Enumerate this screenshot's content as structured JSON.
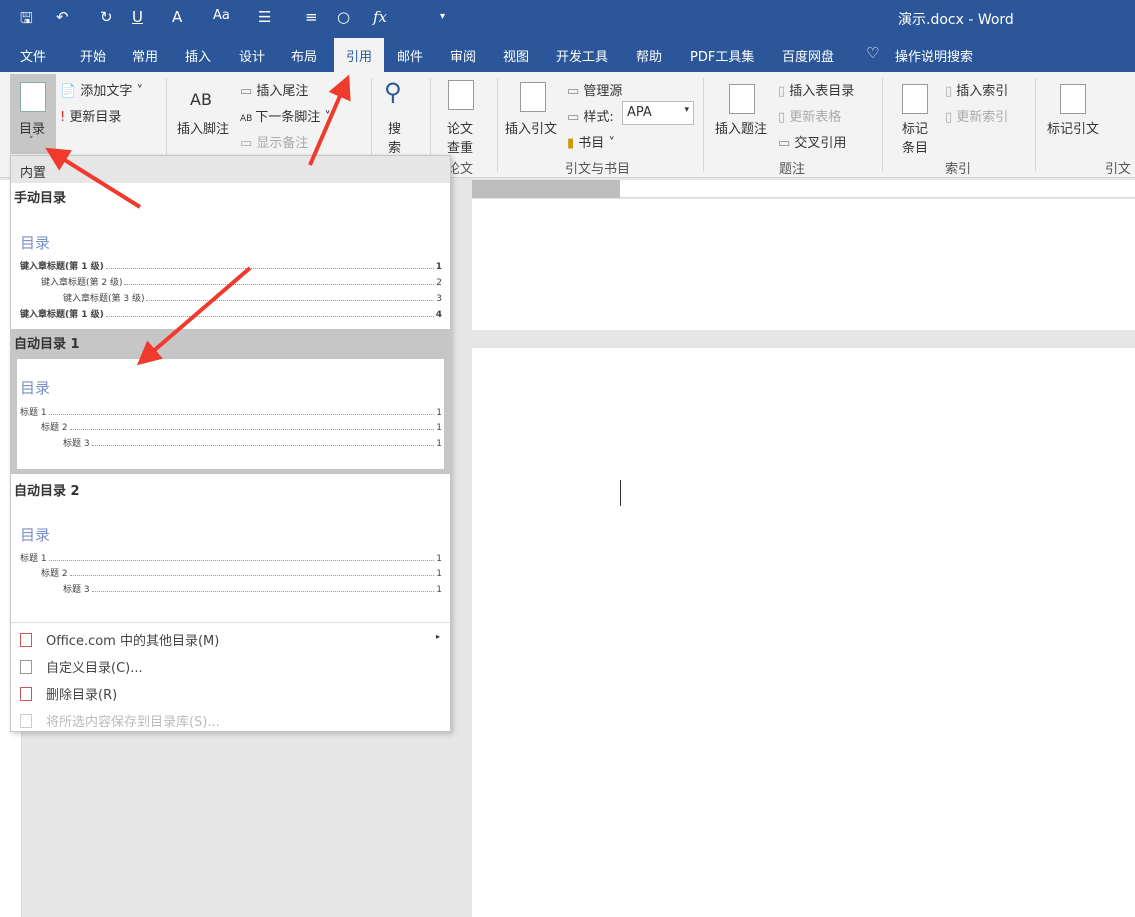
{
  "title": "演示.docx - Word",
  "quick_access": [
    "save-icon",
    "undo-icon",
    "redo-icon",
    "underline-icon",
    "font-color-icon",
    "change-case-icon",
    "bullets-icon",
    "align-icon",
    "shape-icon",
    "formula-icon",
    "customize-icon"
  ],
  "quick_access_glyphs": {
    "save": "🖫",
    "undo": "↶",
    "redo": "↻",
    "underline": "U",
    "fontcolor": "A",
    "case": "Aa",
    "bullets": "☰",
    "align": "≡",
    "shape": "○",
    "fx": "fx",
    "more": "▾"
  },
  "tabs": [
    "文件",
    "开始",
    "常用",
    "插入",
    "设计",
    "布局",
    "引用",
    "邮件",
    "审阅",
    "视图",
    "开发工具",
    "帮助",
    "PDF工具集",
    "百度网盘"
  ],
  "active_tab": "引用",
  "tell_me": "操作说明搜索",
  "ribbon": {
    "toc": {
      "label": "目录",
      "add_text": "添加文字",
      "update": "更新目录"
    },
    "footnotes": {
      "insert_footnote": "插入脚注",
      "insert_endnote": "插入尾注",
      "next_footnote": "下一条脚注",
      "show_notes": "显示备注",
      "ab": "AB"
    },
    "search": {
      "label1": "搜",
      "label2": "索"
    },
    "paper": {
      "label1": "论文",
      "label2": "查重",
      "group": "论文"
    },
    "citations": {
      "insert_citation": "插入引文",
      "manage_sources": "管理源",
      "style_label": "样式:",
      "style_value": "APA",
      "bibliography": "书目",
      "group": "引文与书目"
    },
    "captions": {
      "insert_caption": "插入题注",
      "insert_table_of_figures": "插入表目录",
      "update_table": "更新表格",
      "cross_reference": "交叉引用",
      "group": "题注"
    },
    "index": {
      "mark_entry1": "标记",
      "mark_entry2": "条目",
      "insert_index": "插入索引",
      "update_index": "更新索引",
      "group": "索引"
    },
    "authorities": {
      "mark_citation": "标记引文",
      "group": "引文目"
    }
  },
  "dropdown": {
    "section": "内置",
    "manual": {
      "name": "手动目录",
      "heading": "目录",
      "lines": [
        {
          "text": "键入章标题(第 1 级)",
          "page": "1"
        },
        {
          "text": "键入章标题(第 2 级)",
          "page": "2"
        },
        {
          "text": "键入章标题(第 3 级)",
          "page": "3"
        },
        {
          "text": "键入章标题(第 1 级)",
          "page": "4"
        }
      ]
    },
    "auto1": {
      "name": "自动目录 1",
      "heading": "目录",
      "lines": [
        {
          "text": "标题 1",
          "page": "1"
        },
        {
          "text": "标题 2",
          "page": "1"
        },
        {
          "text": "标题 3",
          "page": "1"
        }
      ]
    },
    "auto2": {
      "name": "自动目录 2",
      "heading": "目录",
      "lines": [
        {
          "text": "标题 1",
          "page": "1"
        },
        {
          "text": "标题 2",
          "page": "1"
        },
        {
          "text": "标题 3",
          "page": "1"
        }
      ]
    },
    "menu": [
      {
        "label": "Office.com 中的其他目录(M)",
        "enabled": true
      },
      {
        "label": "自定义目录(C)...",
        "enabled": true
      },
      {
        "label": "删除目录(R)",
        "enabled": true
      },
      {
        "label": "将所选内容保存到目录库(S)...",
        "enabled": false
      }
    ]
  },
  "colors": {
    "brand": "#2b579a",
    "annotation_arrow": "#f03a2e",
    "toc_heading": "#7a8fc8"
  }
}
